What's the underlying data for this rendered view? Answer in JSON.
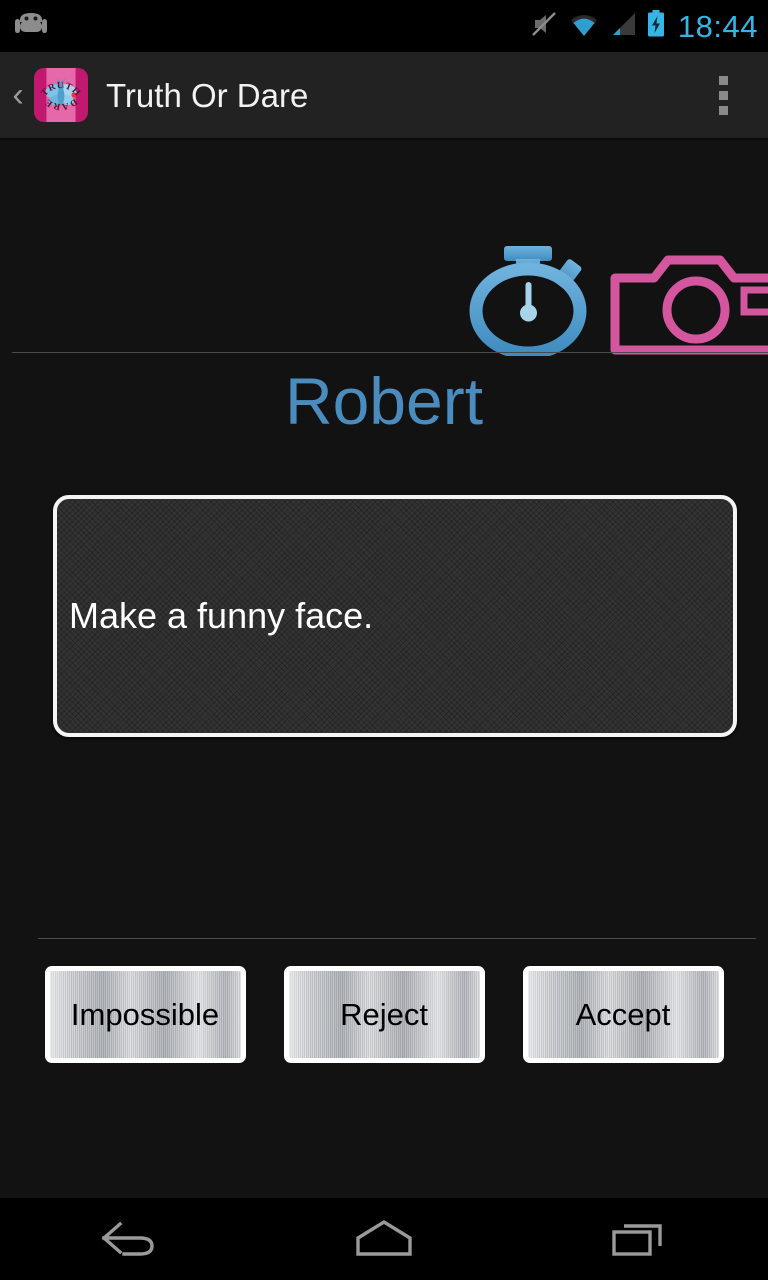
{
  "status_bar": {
    "clock": "18:44",
    "icons": [
      {
        "name": "android-mascot-icon",
        "label": "android"
      },
      {
        "name": "volume-mute-icon",
        "label": "silent"
      },
      {
        "name": "wifi-icon",
        "label": "wifi"
      },
      {
        "name": "cellular-signal-icon",
        "label": "signal"
      },
      {
        "name": "battery-charging-icon",
        "label": "battery charging"
      }
    ],
    "accent_color": "#33b5e5",
    "background": "#000000"
  },
  "action_bar": {
    "back_chevron": "‹",
    "title": "Truth Or Dare",
    "app_icon": {
      "top_text": "TRUTH",
      "bottom_text": "DARE",
      "bg_color": "#c2186f",
      "band_color": "#e569a8",
      "creature_color": "#7ec4e8"
    },
    "overflow_label": "More options",
    "background": "#222222"
  },
  "main": {
    "timer_icon": {
      "name": "stopwatch-icon",
      "color": "#5a9fd4",
      "needle_color": "#a8d4ea"
    },
    "camera_icon": {
      "name": "camera-icon",
      "color": "#d4569e"
    },
    "player_name": "Robert",
    "player_name_color": "#4a8cbd",
    "task_text": "Make a funny face.",
    "card_bg_color": "#333333",
    "card_border_color": "#f4f4f4"
  },
  "buttons": [
    {
      "id": "impossible",
      "label": "Impossible"
    },
    {
      "id": "reject",
      "label": "Reject"
    },
    {
      "id": "accept",
      "label": "Accept"
    }
  ],
  "nav_bar": {
    "back_label": "Back",
    "home_label": "Home",
    "recents_label": "Recent apps",
    "icon_color": "#9a9a9a"
  }
}
